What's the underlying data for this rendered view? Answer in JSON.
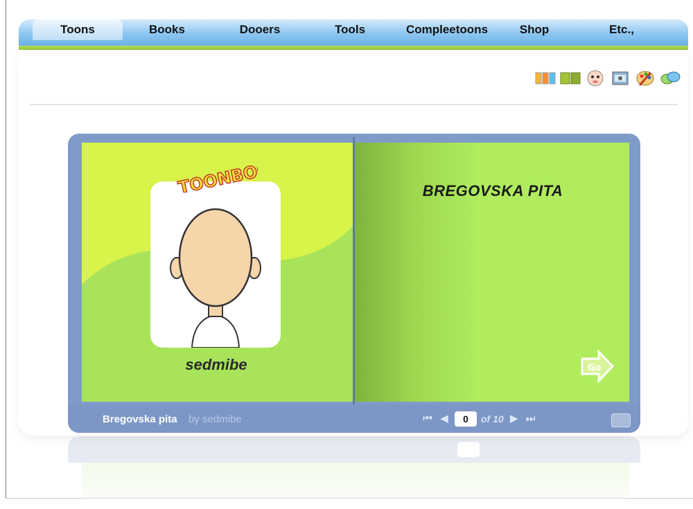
{
  "nav": {
    "items": [
      {
        "label": "Toons",
        "active": true
      },
      {
        "label": "Books",
        "active": false
      },
      {
        "label": "Dooers",
        "active": false
      },
      {
        "label": "Tools",
        "active": false
      },
      {
        "label": "Compleetoons",
        "active": false
      },
      {
        "label": "Shop",
        "active": false
      },
      {
        "label": "Etc.,",
        "active": false
      }
    ]
  },
  "toolbar": {
    "icons": [
      "strips-icon",
      "book-icon",
      "face-icon",
      "photo-icon",
      "palette-icon",
      "chat-icon"
    ]
  },
  "book": {
    "logo": "TOONBOOK",
    "author_label": "sedmibe",
    "page_heading": "BREGOVSKA PITA",
    "go_label": "Go",
    "footer": {
      "title": "Bregovska pita",
      "by": "by sedmibe",
      "current_page": "0",
      "of_label": "of 10"
    }
  },
  "colors": {
    "nav_blue": "#8cc6f1",
    "page_green": "#b0ec5e",
    "book_frame": "#7f9cc9"
  }
}
